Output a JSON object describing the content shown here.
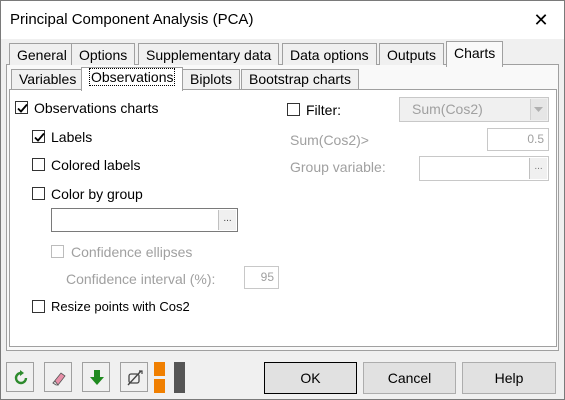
{
  "window": {
    "title": "Principal Component Analysis (PCA)",
    "close_glyph": "✕"
  },
  "tabs_main": [
    {
      "label": "General"
    },
    {
      "label": "Options"
    },
    {
      "label": "Supplementary data"
    },
    {
      "label": "Data options"
    },
    {
      "label": "Outputs"
    },
    {
      "label": "Charts",
      "active": true
    }
  ],
  "tabs_sub": [
    {
      "label": "Variables"
    },
    {
      "label": "Observations",
      "active": true
    },
    {
      "label": "Biplots"
    },
    {
      "label": "Bootstrap charts"
    }
  ],
  "options": {
    "observations_charts": {
      "label": "Observations charts",
      "checked": true
    },
    "labels": {
      "label": "Labels",
      "checked": true
    },
    "colored_labels": {
      "label": "Colored labels",
      "checked": false
    },
    "color_by_group": {
      "label": "Color by group",
      "checked": false
    },
    "group_field_value": "",
    "confidence_ellipses": {
      "label": "Confidence ellipses",
      "checked": false,
      "enabled": false
    },
    "confidence_interval_label": "Confidence interval (%):",
    "confidence_interval_value": "95",
    "resize_points": {
      "label": "Resize points with Cos2",
      "checked": false
    }
  },
  "filter": {
    "label": "Filter:",
    "checked": false,
    "combo_value": "Sum(Cos2)",
    "sum_label": "Sum(Cos2)>",
    "sum_value": "0.5",
    "group_variable_label": "Group variable:",
    "group_variable_value": ""
  },
  "buttons": {
    "ok": "OK",
    "cancel": "Cancel",
    "help": "Help"
  },
  "icons": {
    "reset": "refresh-icon",
    "eraser": "eraser-icon",
    "down": "down-arrow-icon",
    "clear": "clear-selection-icon",
    "layout": "layout-toggle-icon"
  },
  "colors": {
    "accent_green": "#2e8b2e",
    "accent_orange": "#f07f00"
  }
}
